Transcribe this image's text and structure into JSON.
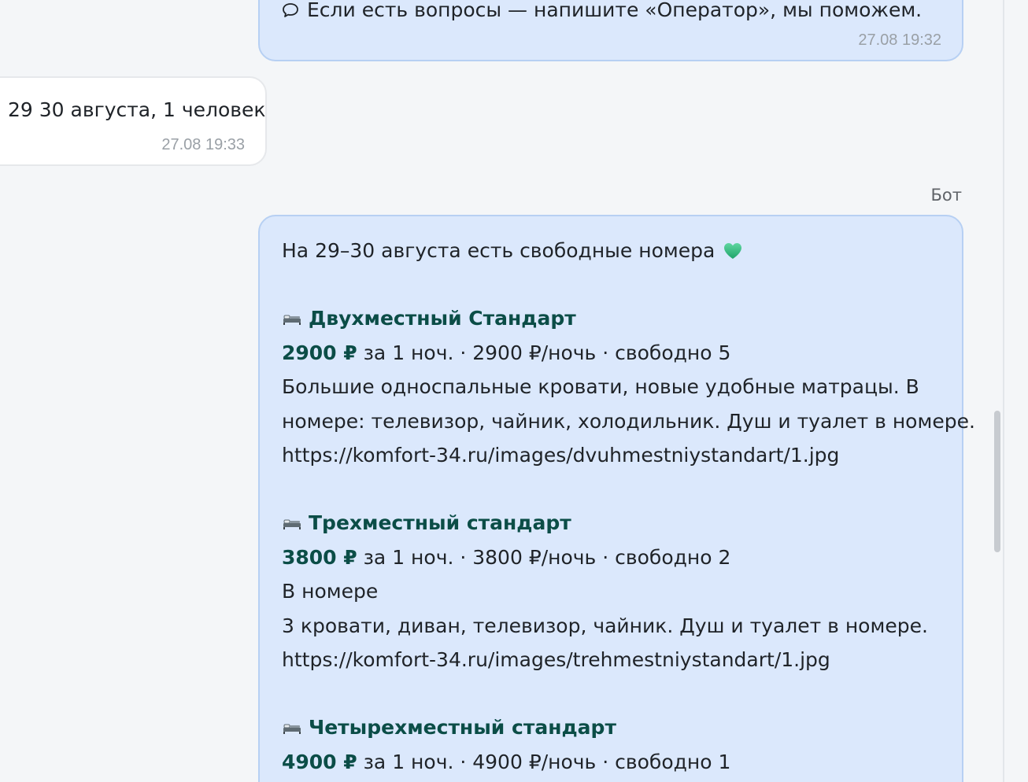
{
  "messages": {
    "bot_top": {
      "icon": "chat-bubble-icon",
      "text": "Если есть вопросы — напишите «Оператор», мы поможем.",
      "time": "27.08 19:32"
    },
    "user": {
      "text": "29 30 августа, 1 человек",
      "time": "27.08 19:33"
    },
    "bot_label": "Бот",
    "bot_main": {
      "intro": "На 29–30 августа есть свободные номера",
      "intro_emoji": "green-heart-icon",
      "rooms": [
        {
          "icon": "bed-icon",
          "title": "Двухместный Стандарт",
          "price": "2900 ₽",
          "price_detail": " за 1 ноч. · 2900 ₽/ночь · свободно 5",
          "desc_lines": [
            "Большие односпальные кровати, новые удобные матрацы. В",
            "номере: телевизор, чайник, холодильник. Душ и туалет в номере.",
            "https://komfort-34.ru/images/dvuhmestniystandart/1.jpg"
          ]
        },
        {
          "icon": "bed-icon",
          "title": "Трехместный стандарт",
          "price": "3800 ₽",
          "price_detail": " за 1 ноч. · 3800 ₽/ночь · свободно 2",
          "desc_lines": [
            "В номере",
            "3 кровати, диван, телевизор, чайник. Душ и туалет в номере.",
            "https://komfort-34.ru/images/trehmestniystandart/1.jpg"
          ]
        },
        {
          "icon": "bed-icon",
          "title": "Четырехместный стандарт",
          "price": "4900 ₽",
          "price_detail": " за 1 ноч. · 4900 ₽/ночь · свободно 1",
          "desc_lines": []
        }
      ]
    }
  },
  "colors": {
    "bot_bubble": "#dbe8fc",
    "bot_border": "#b7d0f3",
    "accent_text": "#0b4d47",
    "timestamp": "#9aa0a6"
  }
}
